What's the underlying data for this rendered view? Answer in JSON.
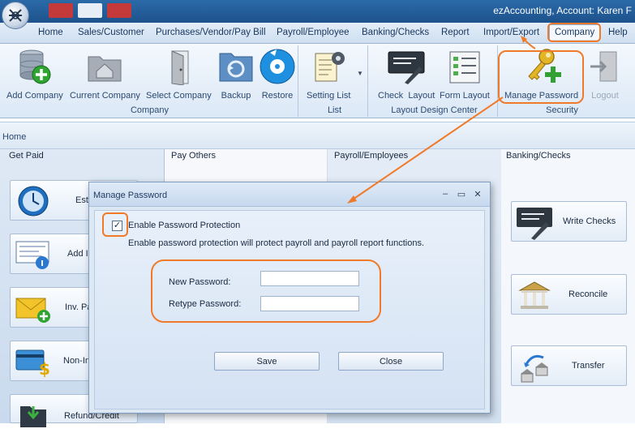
{
  "window": {
    "title": "ezAccounting, Account: Karen F"
  },
  "menu": {
    "items": [
      {
        "label": "Home"
      },
      {
        "label": "Sales/Customer"
      },
      {
        "label": "Purchases/Vendor/Pay Bill"
      },
      {
        "label": "Payroll/Employee"
      },
      {
        "label": "Banking/Checks"
      },
      {
        "label": "Report"
      },
      {
        "label": "Import/Export"
      },
      {
        "label": "Company"
      },
      {
        "label": "Help"
      }
    ]
  },
  "ribbon": {
    "groups": [
      {
        "label": "Company"
      },
      {
        "label": "List"
      },
      {
        "label": "Layout Design Center"
      },
      {
        "label": "Security"
      }
    ],
    "buttons": [
      {
        "label": "Add Company",
        "icon": "add-database-icon"
      },
      {
        "label": "Current Company",
        "icon": "folder-home-icon"
      },
      {
        "label": "Select Company",
        "icon": "open-door-icon"
      },
      {
        "label": "Backup",
        "icon": "backup-folder-icon"
      },
      {
        "label": "Restore",
        "icon": "restore-disc-icon"
      },
      {
        "label": "Setting List",
        "icon": "settings-list-icon"
      },
      {
        "label": "Check",
        "icon": "check-pen-icon"
      },
      {
        "label": "Layout",
        "icon": ""
      },
      {
        "label": "Form Layout",
        "icon": "form-layout-icon"
      },
      {
        "label": "Manage Password",
        "icon": "key-plus-icon"
      },
      {
        "label": "Logout",
        "icon": "logout-icon"
      }
    ]
  },
  "home": {
    "label": "Home"
  },
  "columns": {
    "get_paid": {
      "header": "Get Paid",
      "tasks": [
        "Esti",
        "Add I",
        "Inv. Pa",
        "Non-In",
        "Refund/Credit"
      ]
    },
    "pay_others": {
      "header": "Pay Others"
    },
    "payroll": {
      "header": "Payroll/Employees"
    },
    "banking": {
      "header": "Banking/Checks",
      "tasks": [
        "Write Checks",
        "Reconcile",
        "Transfer"
      ]
    }
  },
  "dialog": {
    "title": "Manage Password",
    "controls": {
      "minimize": "–",
      "maximize": "▭",
      "close": "✕"
    },
    "enable_label": "Enable Password Protection",
    "enable_checked": true,
    "checkmark": "✓",
    "description": "Enable password protection will protect payroll and payroll report functions.",
    "new_password_label": "New Password:",
    "new_password_value": "",
    "retype_password_label": "Retype Password:",
    "retype_password_value": "",
    "save_label": "Save",
    "close_label": "Close"
  },
  "colors": {
    "annotation": "#f07a2a",
    "titlebar": "#1d528c"
  }
}
